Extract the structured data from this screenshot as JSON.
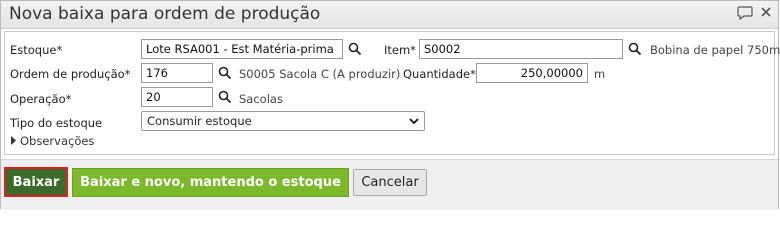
{
  "dialog": {
    "title": "Nova baixa para ordem de produção",
    "chat_icon": "speech-bubble-icon",
    "close_icon": "close-icon"
  },
  "form": {
    "estoque": {
      "label": "Estoque*",
      "value": "Lote RSA001 - Est Matéria-prima"
    },
    "item": {
      "label": "Item*",
      "value": "S0002",
      "description": "Bobina de papel 750m"
    },
    "ordem": {
      "label": "Ordem de produção*",
      "value": "176",
      "description": "S0005 Sacola C (A produzir)"
    },
    "quantidade": {
      "label": "Quantidade*",
      "value": "250,00000",
      "unit": "m"
    },
    "operacao": {
      "label": "Operação*",
      "value": "20",
      "description": "Sacolas"
    },
    "tipo_estoque": {
      "label": "Tipo do estoque",
      "selected": "Consumir estoque"
    },
    "observacoes": {
      "label": "Observações"
    }
  },
  "footer": {
    "baixar": "Baixar",
    "baixar_novo": "Baixar e novo, mantendo o estoque",
    "cancelar": "Cancelar"
  },
  "colors": {
    "primary_button": "#3a6b2a",
    "secondary_button": "#7cb92a",
    "focus_border": "#e02020"
  }
}
